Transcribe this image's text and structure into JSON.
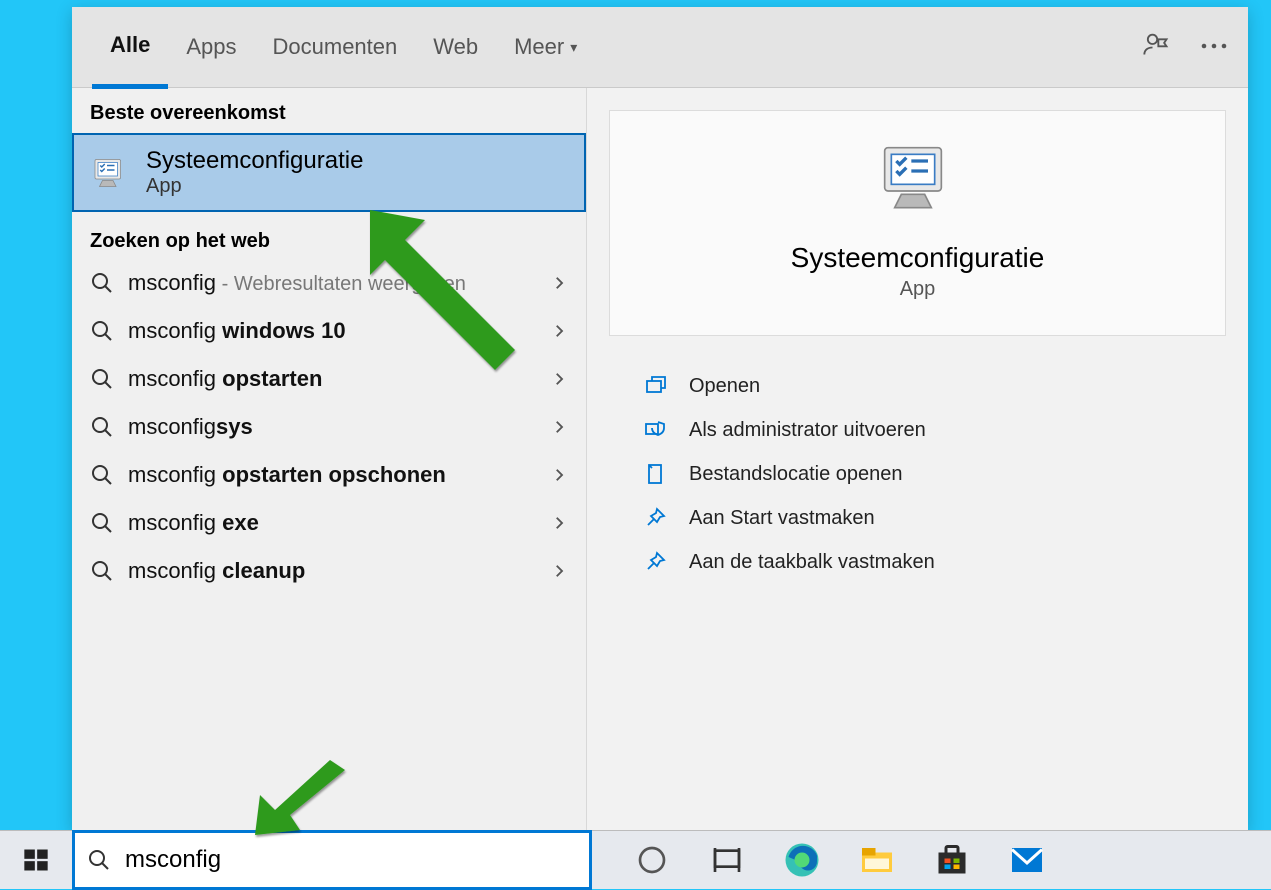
{
  "tabs": {
    "all": "Alle",
    "apps": "Apps",
    "documents": "Documenten",
    "web": "Web",
    "more": "Meer"
  },
  "sections": {
    "bestMatch": "Beste overeenkomst",
    "webSearch": "Zoeken op het web"
  },
  "bestMatch": {
    "title": "Systeemconfiguratie",
    "subtitle": "App"
  },
  "webItems": [
    {
      "prefix": "msconfig",
      "bold": "",
      "hint": " - Webresultaten weergeven"
    },
    {
      "prefix": "msconfig ",
      "bold": "windows 10",
      "hint": ""
    },
    {
      "prefix": "msconfig ",
      "bold": "opstarten",
      "hint": ""
    },
    {
      "prefix": "msconfig",
      "bold": "sys",
      "hint": ""
    },
    {
      "prefix": "msconfig ",
      "bold": "opstarten opschonen",
      "hint": ""
    },
    {
      "prefix": "msconfig ",
      "bold": "exe",
      "hint": ""
    },
    {
      "prefix": "msconfig ",
      "bold": "cleanup",
      "hint": ""
    }
  ],
  "detail": {
    "title": "Systeemconfiguratie",
    "type": "App",
    "actions": {
      "open": "Openen",
      "runAdmin": "Als administrator uitvoeren",
      "openLocation": "Bestandslocatie openen",
      "pinStart": "Aan Start vastmaken",
      "pinTaskbar": "Aan de taakbalk vastmaken"
    }
  },
  "search": {
    "value": "msconfig"
  },
  "colors": {
    "accent": "#0078d4",
    "highlightBg": "#a9cbe9",
    "arrow": "#2e9a1f"
  }
}
